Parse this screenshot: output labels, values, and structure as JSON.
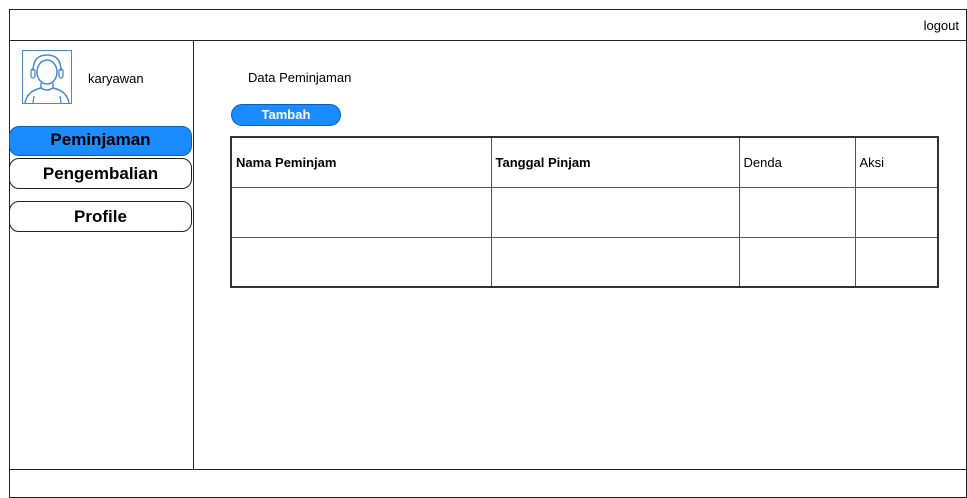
{
  "header": {
    "logout_label": "logout"
  },
  "sidebar": {
    "user": {
      "name": "karyawan",
      "avatar_icon": "user-avatar-icon"
    },
    "items": [
      {
        "label": "Peminjaman",
        "active": true
      },
      {
        "label": "Pengembalian",
        "active": false
      },
      {
        "label": "Profile",
        "active": false
      }
    ]
  },
  "main": {
    "title": "Data Peminjaman",
    "add_label": "Tambah",
    "table": {
      "headers": [
        "Nama Peminjam",
        "Tanggal Pinjam",
        "Denda",
        "Aksi"
      ],
      "rows": [
        [
          "",
          "",
          "",
          ""
        ],
        [
          "",
          "",
          "",
          ""
        ]
      ]
    }
  },
  "colors": {
    "accent": "#1a8cff",
    "border": "#222222"
  }
}
